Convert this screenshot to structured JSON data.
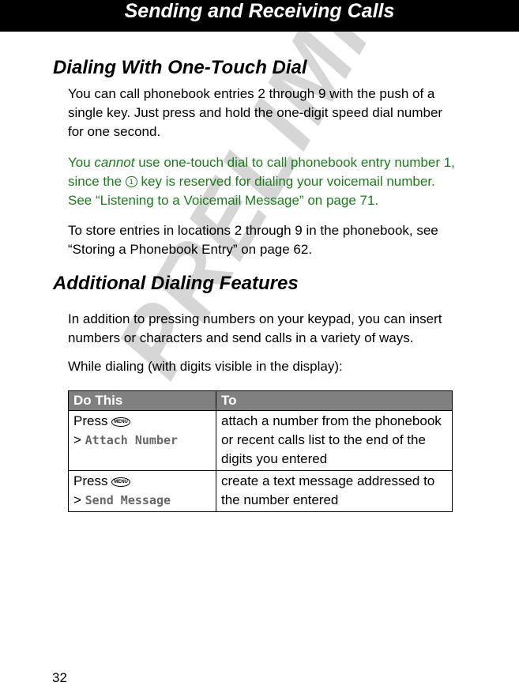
{
  "header": {
    "title": "Sending and Receiving Calls"
  },
  "watermark": "PRELIMINARY",
  "section1": {
    "heading": "Dialing With One-Touch Dial",
    "para1": "You can call phonebook entries 2 through 9 with the push of a single key. Just press and hold the one-digit speed dial number for one second.",
    "note_prefix": "You ",
    "note_italic": "cannot",
    "note_mid": " use one-touch dial to call phonebook entry number 1, since the ",
    "note_key": "1",
    "note_end": " key is reserved for dialing your voicemail number. See “Listening to a Voicemail Message” on page 71.",
    "para3": "To store entries in locations 2 through 9 in the phonebook, see “Storing a Phonebook Entry” on page 62."
  },
  "section2": {
    "heading": "Additional Dialing Features",
    "para1": "In addition to pressing numbers on your keypad, you can insert numbers or characters and send calls in a variety of ways.",
    "para2": "While dialing (with digits visible in the display):"
  },
  "table": {
    "headers": [
      "Do This",
      "To"
    ],
    "rows": [
      {
        "press": "Press",
        "key": "MENU",
        "menu_item": "Attach Number",
        "desc": "attach a number from the phonebook or recent calls list to the end of the digits you entered"
      },
      {
        "press": "Press",
        "key": "MENU",
        "menu_item": "Send Message",
        "desc": "create a text message addressed to the number entered"
      }
    ]
  },
  "page_number": "32"
}
